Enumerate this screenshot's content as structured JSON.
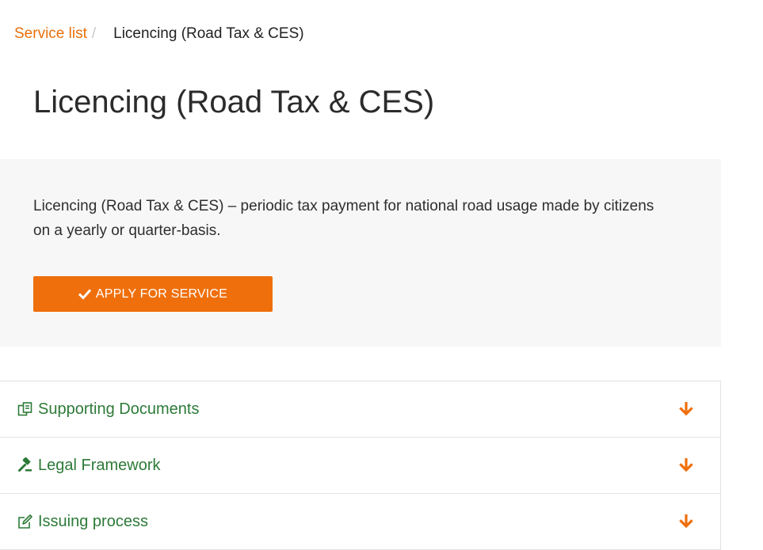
{
  "breadcrumb": {
    "parent": "Service list",
    "separator": "/",
    "current": "Licencing (Road Tax & CES)"
  },
  "page_title": "Licencing (Road Tax & CES)",
  "info": {
    "description": "Licencing (Road Tax & CES) – periodic tax payment for national road usage made by citizens on a yearly or quarter-basis.",
    "apply_label": "APPLY FOR SERVICE",
    "apply_icon": "check-icon"
  },
  "accordion": {
    "items": [
      {
        "label": "Supporting Documents",
        "icon": "documents-icon"
      },
      {
        "label": "Legal Framework",
        "icon": "gavel-icon"
      },
      {
        "label": "Issuing process",
        "icon": "edit-icon"
      }
    ],
    "expand_icon": "arrow-down-icon"
  },
  "colors": {
    "accent": "#ef6f0c",
    "link": "#e8700c",
    "section_label": "#2d7a38",
    "panel_bg": "#f7f7f7"
  }
}
